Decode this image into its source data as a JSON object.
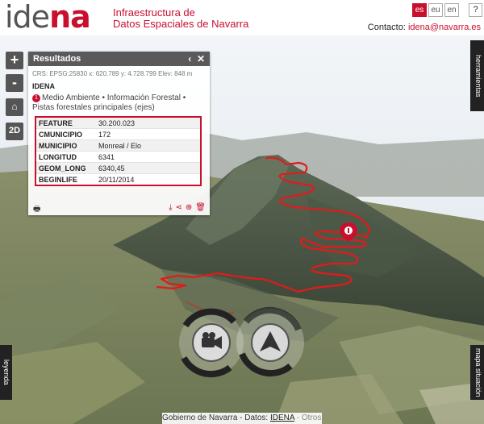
{
  "header": {
    "logo_ide": "ide",
    "logo_na": "na",
    "subtitle_line1": "Infraestructura de",
    "subtitle_line2": "Datos Espaciales de Navarra",
    "languages": [
      "es",
      "eu",
      "en"
    ],
    "help_label": "?",
    "contact_label": "Contacto:",
    "contact_email": "idena@navarra.es"
  },
  "controls": {
    "zoom_in": "+",
    "zoom_out": "-",
    "home_icon": "home-icon",
    "view_mode": "2D"
  },
  "results": {
    "title": "Resultados",
    "crs": "CRS: EPSG:25830   x: 620.789   y: 4.728.799   Elev: 848 m",
    "source": "IDENA",
    "layer_number": "1",
    "layer_name": "Medio Ambiente • Información Forestal • Pistas forestales principales (ejes)",
    "attributes": [
      {
        "key": "FEATURE",
        "value": "30.200.023"
      },
      {
        "key": "CMUNICIPIO",
        "value": "172"
      },
      {
        "key": "MUNICIPIO",
        "value": "Monreal / Elo"
      },
      {
        "key": "LONGITUD",
        "value": "6341"
      },
      {
        "key": "GEOM_LONG",
        "value": "6340,45"
      },
      {
        "key": "BEGINLIFE",
        "value": "20/11/2014"
      }
    ]
  },
  "side_tabs": {
    "herramientas": "herramientas",
    "leyenda": "leyenda",
    "mapa_situacion": "mapa situación"
  },
  "footer": {
    "owner": "Gobierno de Navarra",
    "data_label": " - Datos: ",
    "data_link": "IDENA",
    "others": " - Otros..."
  },
  "colors": {
    "brand_red": "#c8102e",
    "panel_header": "#5a5a5a"
  }
}
